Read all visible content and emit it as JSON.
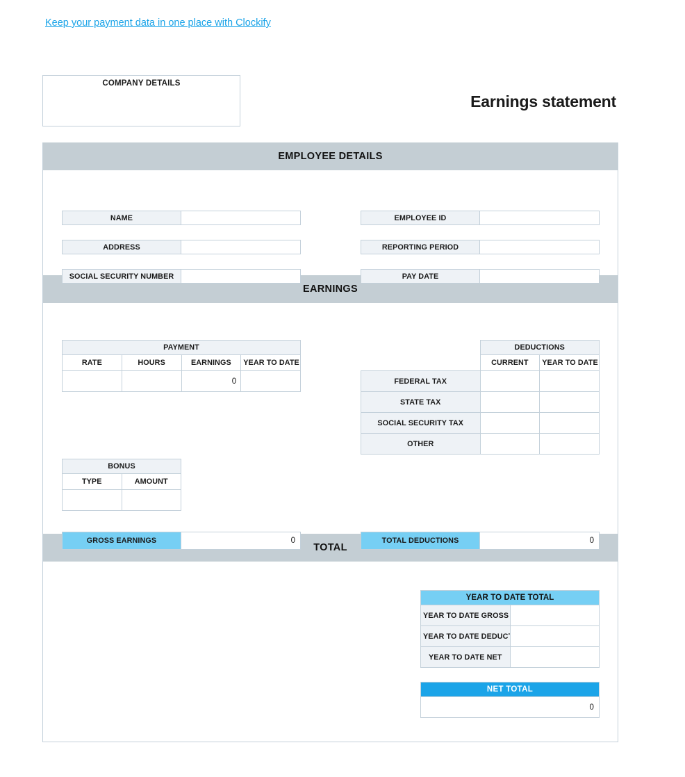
{
  "promo": {
    "link_text": "Keep your payment data in one place with Clockify",
    "link_color": "#1ba4e8"
  },
  "header": {
    "company_box_label": "COMPANY DETAILS",
    "title": "Earnings statement"
  },
  "colors": {
    "section_band": "#c4ced4",
    "field_label_bg": "#eef2f6",
    "accent_light_blue": "#76cff4",
    "accent_blue": "#1ba4e8",
    "border": "#c3d0da"
  },
  "sections": {
    "employee_details": {
      "band_title": "EMPLOYEE DETAILS",
      "left_fields": [
        {
          "label": "NAME",
          "value": ""
        },
        {
          "label": "ADDRESS",
          "value": ""
        },
        {
          "label": "SOCIAL SECURITY NUMBER",
          "value": ""
        }
      ],
      "right_fields": [
        {
          "label": "EMPLOYEE ID",
          "value": ""
        },
        {
          "label": "REPORTING PERIOD",
          "value": ""
        },
        {
          "label": "PAY DATE",
          "value": ""
        }
      ]
    },
    "earnings": {
      "band_title": "EARNINGS",
      "payment_table": {
        "caption": "PAYMENT",
        "columns": [
          "RATE",
          "HOURS",
          "EARNINGS",
          "YEAR TO DATE"
        ],
        "rows": [
          {
            "rate": "",
            "hours": "",
            "earnings": "0",
            "year_to_date": ""
          }
        ]
      },
      "bonus_table": {
        "caption": "BONUS",
        "columns": [
          "TYPE",
          "AMOUNT"
        ],
        "rows": [
          {
            "type": "",
            "amount": ""
          }
        ]
      },
      "deductions_table": {
        "caption": "DEDUCTIONS",
        "columns": [
          "CURRENT",
          "YEAR TO DATE"
        ],
        "rows": [
          {
            "label": "FEDERAL TAX",
            "current": "",
            "year_to_date": ""
          },
          {
            "label": "STATE TAX",
            "current": "",
            "year_to_date": ""
          },
          {
            "label": "SOCIAL SECURITY TAX",
            "current": "",
            "year_to_date": ""
          },
          {
            "label": "OTHER",
            "current": "",
            "year_to_date": ""
          }
        ]
      },
      "gross_earnings": {
        "label": "GROSS EARNINGS",
        "value": "0"
      },
      "total_deductions": {
        "label": "TOTAL DEDUCTIONS",
        "value": "0"
      }
    },
    "total": {
      "band_title": "TOTAL",
      "ytd_table": {
        "caption": "YEAR TO DATE TOTAL",
        "rows": [
          {
            "label": "YEAR TO DATE GROSS",
            "value": ""
          },
          {
            "label": "YEAR TO DATE DEDUCTIONS",
            "value": ""
          },
          {
            "label": "YEAR TO DATE NET",
            "value": ""
          }
        ]
      },
      "net_total": {
        "caption": "NET TOTAL",
        "value": "0"
      }
    }
  }
}
